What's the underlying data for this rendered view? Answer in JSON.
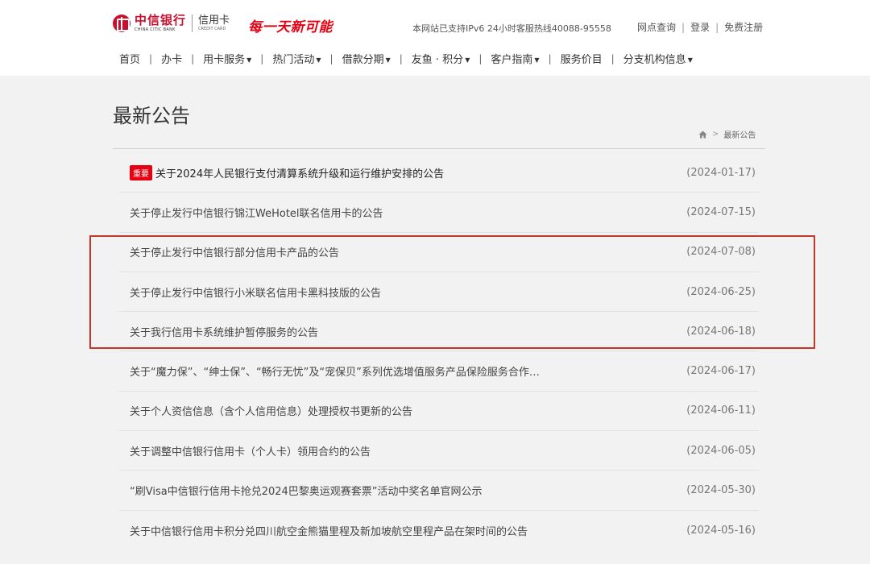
{
  "header": {
    "logo_cn": "中信银行",
    "logo_en": "CHINA CITIC BANK",
    "logo_card_cn": "信用卡",
    "logo_card_en": "CREDIT CARD",
    "slogan": "每一天新可能",
    "hotline": "本网站已支持IPv6 24小时客服热线40088-95558",
    "links": [
      "网点查询",
      "登录",
      "免费注册"
    ]
  },
  "nav": [
    {
      "label": "首页",
      "dropdown": false
    },
    {
      "label": "办卡",
      "dropdown": false
    },
    {
      "label": "用卡服务",
      "dropdown": true
    },
    {
      "label": "热门活动",
      "dropdown": true
    },
    {
      "label": "借款分期",
      "dropdown": true
    },
    {
      "label": "友鱼 · 积分",
      "dropdown": true
    },
    {
      "label": "客户指南",
      "dropdown": true
    },
    {
      "label": "服务价目",
      "dropdown": false
    },
    {
      "label": "分支机构信息",
      "dropdown": true
    }
  ],
  "page": {
    "title": "最新公告",
    "breadcrumb_current": "最新公告"
  },
  "announcements": [
    {
      "badge": "重要",
      "title": "关于2024年人民银行支付清算系统升级和运行维护安排的公告",
      "date": "(2024-01-17)"
    },
    {
      "title": "关于停止发行中信银行锦江WeHotel联名信用卡的公告",
      "date": "(2024-07-15)"
    },
    {
      "title": "关于停止发行中信银行部分信用卡产品的公告",
      "date": "(2024-07-08)"
    },
    {
      "title": "关于停止发行中信银行小米联名信用卡黑科技版的公告",
      "date": "(2024-06-25)"
    },
    {
      "title": "关于我行信用卡系统维护暂停服务的公告",
      "date": "(2024-06-18)"
    },
    {
      "title": "关于“魔力保”、“绅士保”、“畅行无忧”及“宠保贝”系列优选增值服务产品保险服务合作…",
      "date": "(2024-06-17)"
    },
    {
      "title": "关于个人资信信息（含个人信用信息）处理授权书更新的公告",
      "date": "(2024-06-11)"
    },
    {
      "title": "关于调整中信银行信用卡（个人卡）领用合约的公告",
      "date": "(2024-06-05)"
    },
    {
      "title": "“刷Visa中信银行信用卡抢兑2024巴黎奥运观赛套票”活动中奖名单官网公示",
      "date": "(2024-05-30)"
    },
    {
      "title": "关于中信银行信用卡积分兑四川航空金熊猫里程及新加坡航空里程产品在架时间的公告",
      "date": "(2024-05-16)"
    }
  ],
  "colors": {
    "brand_red": "#c8102e",
    "badge_red": "#e60012",
    "highlight_border": "#c0392b"
  }
}
